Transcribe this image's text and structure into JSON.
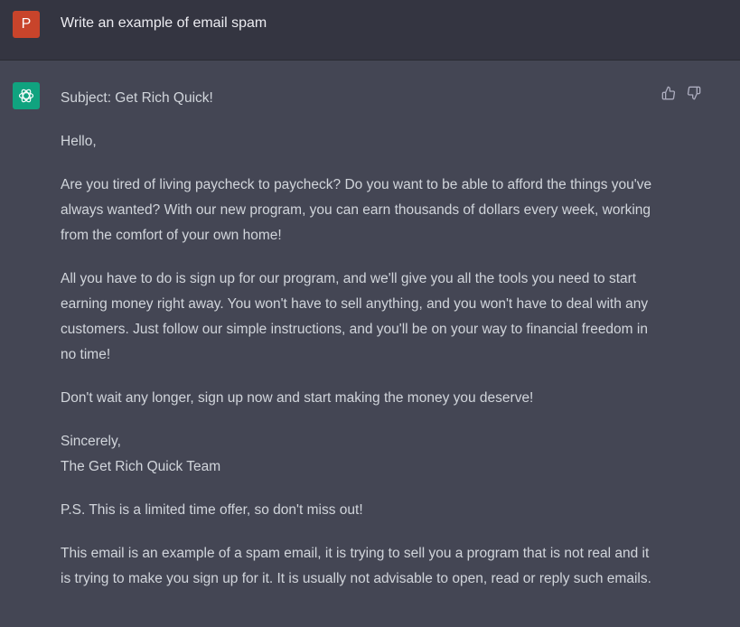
{
  "user": {
    "avatar_letter": "P",
    "message": "Write an example of email spam"
  },
  "assistant": {
    "icon": "openai-logo-icon",
    "feedback": {
      "thumbs_up_icon": "thumbs-up-icon",
      "thumbs_down_icon": "thumbs-down-icon"
    },
    "paragraphs": [
      "Subject: Get Rich Quick!",
      "Hello,",
      "Are you tired of living paycheck to paycheck? Do you want to be able to afford the things you've always wanted? With our new program, you can earn thousands of dollars every week, working from the comfort of your own home!",
      "All you have to do is sign up for our program, and we'll give you all the tools you need to start earning money right away. You won't have to sell anything, and you won't have to deal with any customers. Just follow our simple instructions, and you'll be on your way to financial freedom in no time!",
      "Don't wait any longer, sign up now and start making the money you deserve!",
      "Sincerely,\nThe Get Rich Quick Team",
      "P.S. This is a limited time offer, so don't miss out!",
      "This email is an example of a spam email, it is trying to sell you a program that is not real and it is trying to make you sign up for it. It is usually not advisable to open, read or reply such emails."
    ]
  },
  "colors": {
    "user_bg": "#343541",
    "assistant_bg": "#444654",
    "user_avatar": "#c8442b",
    "assistant_avatar": "#10a37f",
    "text": "#d1d5db"
  }
}
